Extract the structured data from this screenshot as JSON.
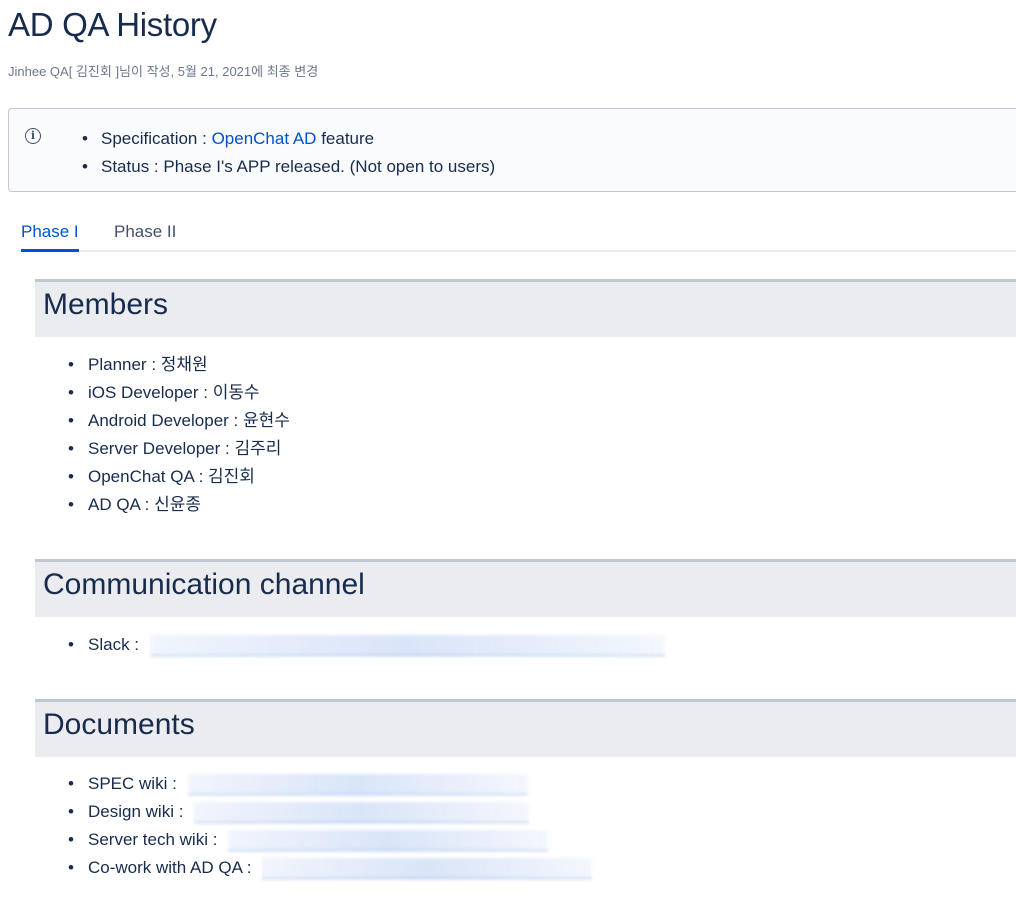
{
  "page": {
    "title": "AD QA History",
    "byline": {
      "prefix": "Jinhee QA[",
      "author": " 김진회 ",
      "suffix": "]님이 작성, 5월 21, 2021에 최종 변경"
    }
  },
  "info_panel": {
    "icon": "info-icon",
    "spec_label": "Specification : ",
    "spec_link": "OpenChat AD",
    "spec_suffix": " feature",
    "status": "Status : Phase I's APP released. (Not open to users)"
  },
  "tabs": [
    {
      "label": "Phase I",
      "active": true
    },
    {
      "label": "Phase II",
      "active": false
    }
  ],
  "members": {
    "heading": "Members",
    "items": [
      "Planner : 정채원",
      "iOS Developer : 이동수",
      "Android Developer : 윤현수",
      "Server Developer : 김주리",
      "OpenChat QA : 김진회",
      "AD QA : 신윤종"
    ]
  },
  "communication": {
    "heading": "Communication channel",
    "items": [
      {
        "label": "Slack : "
      }
    ]
  },
  "documents": {
    "heading": "Documents",
    "items": [
      {
        "label": "SPEC wiki : "
      },
      {
        "label": "Design wiki : "
      },
      {
        "label": "Server tech wiki : "
      },
      {
        "label": "Co-work with AD QA : "
      }
    ]
  },
  "colors": {
    "link": "#0052cc",
    "text": "#172b4d",
    "section_bg": "#ebecf0"
  }
}
